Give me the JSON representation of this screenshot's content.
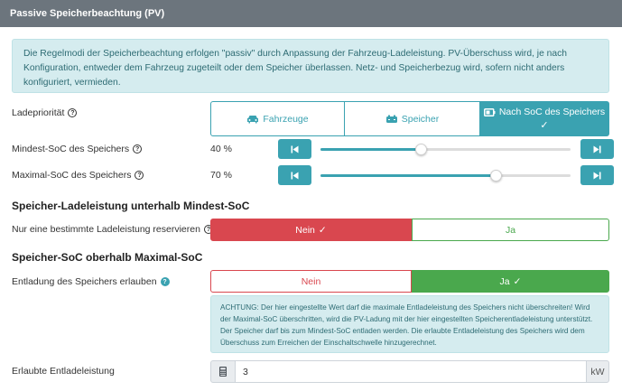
{
  "header": {
    "title": "Passive Speicherbeachtung (PV)"
  },
  "info": {
    "text": "Die Regelmodi der Speicherbeachtung erfolgen \"passiv\" durch Anpassung der Fahrzeug-Ladeleistung. PV-Überschuss wird, je nach Konfiguration, entweder dem Fahrzeug zugeteilt oder dem Speicher überlassen. Netz- und Speicherbezug wird, sofern nicht anders konfiguriert, vermieden."
  },
  "ladeprioritaet": {
    "label": "Ladepriorität",
    "options": [
      {
        "label": "Fahrzeuge",
        "icon": "car-icon"
      },
      {
        "label": "Speicher",
        "icon": "battery-car-icon"
      },
      {
        "label": "Nach SoC des Speichers",
        "icon": "battery-icon",
        "check": "✓"
      }
    ],
    "selected": "Nach SoC des Speichers"
  },
  "mindest_soc": {
    "label": "Mindest-SoC des Speichers",
    "value": "40 %",
    "fraction": 0.4
  },
  "maximal_soc": {
    "label": "Maximal-SoC des Speichers",
    "value": "70 %",
    "fraction": 0.7
  },
  "section1": {
    "title": "Speicher-Ladeleistung unterhalb Mindest-SoC"
  },
  "reservieren": {
    "label": "Nur eine bestimmte Ladeleistung reservieren",
    "no": "Nein",
    "yes": "Ja",
    "check": "✓",
    "selected": "Nein"
  },
  "section2": {
    "title": "Speicher-SoC oberhalb Maximal-SoC"
  },
  "entladung": {
    "label": "Entladung des Speichers erlauben",
    "no": "Nein",
    "yes": "Ja",
    "check": "✓",
    "selected": "Ja"
  },
  "warning": {
    "text": "ACHTUNG: Der hier eingestellte Wert darf die maximale Entladeleistung des Speichers nicht überschreiten! Wird der Maximal-SoC überschritten, wird die PV-Ladung mit der hier eingestellten Speicherentladeleistung unterstützt. Der Speicher darf bis zum Mindest-SoC entladen werden. Die erlaubte Entladeleistung des Speichers wird dem Überschuss zum Erreichen der Einschaltschwelle hinzugerechnet."
  },
  "entladeleistung": {
    "label": "Erlaubte Entladeleistung",
    "value": "3",
    "unit": "kW"
  },
  "colors": {
    "teal": "#3aa2b1",
    "red": "#d9474f",
    "green": "#4aa84d",
    "header": "#6c757d"
  }
}
